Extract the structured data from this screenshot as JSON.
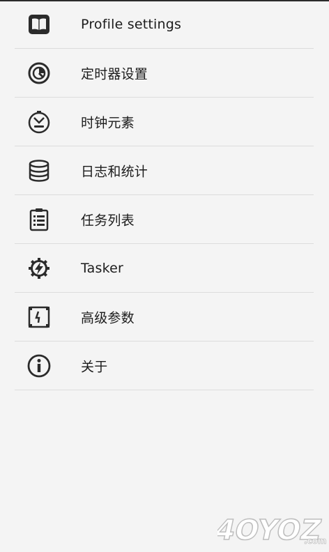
{
  "menu": {
    "items": [
      {
        "label": "Profile settings",
        "icon": "book-icon"
      },
      {
        "label": "定时器设置",
        "icon": "timer-icon"
      },
      {
        "label": "时钟元素",
        "icon": "clock-icon"
      },
      {
        "label": "日志和统计",
        "icon": "database-icon"
      },
      {
        "label": "任务列表",
        "icon": "clipboard-icon"
      },
      {
        "label": "Tasker",
        "icon": "tasker-gear-icon"
      },
      {
        "label": "高级参数",
        "icon": "advanced-params-icon"
      },
      {
        "label": "关于",
        "icon": "info-icon"
      }
    ]
  },
  "watermark": {
    "brand": "4OYOZ",
    "suffix": ".com"
  }
}
